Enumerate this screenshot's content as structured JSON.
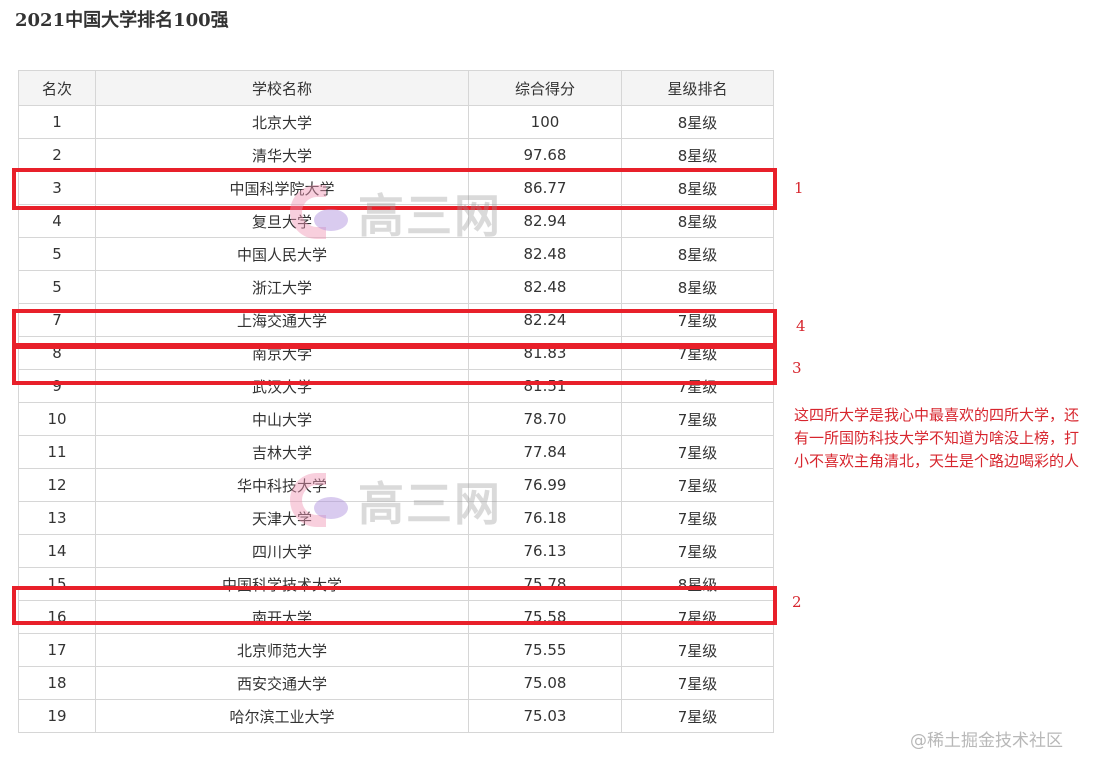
{
  "title": "2021中国大学排名100强",
  "table": {
    "headers": [
      "名次",
      "学校名称",
      "综合得分",
      "星级排名"
    ],
    "rows": [
      [
        "1",
        "北京大学",
        "100",
        "8星级"
      ],
      [
        "2",
        "清华大学",
        "97.68",
        "8星级"
      ],
      [
        "3",
        "中国科学院大学",
        "86.77",
        "8星级"
      ],
      [
        "4",
        "复旦大学",
        "82.94",
        "8星级"
      ],
      [
        "5",
        "中国人民大学",
        "82.48",
        "8星级"
      ],
      [
        "5",
        "浙江大学",
        "82.48",
        "8星级"
      ],
      [
        "7",
        "上海交通大学",
        "82.24",
        "7星级"
      ],
      [
        "8",
        "南京大学",
        "81.83",
        "7星级"
      ],
      [
        "9",
        "武汉大学",
        "81.51",
        "7星级"
      ],
      [
        "10",
        "中山大学",
        "78.70",
        "7星级"
      ],
      [
        "11",
        "吉林大学",
        "77.84",
        "7星级"
      ],
      [
        "12",
        "华中科技大学",
        "76.99",
        "7星级"
      ],
      [
        "13",
        "天津大学",
        "76.18",
        "7星级"
      ],
      [
        "14",
        "四川大学",
        "76.13",
        "7星级"
      ],
      [
        "15",
        "中国科学技术大学",
        "75.78",
        "8星级"
      ],
      [
        "16",
        "南开大学",
        "75.58",
        "7星级"
      ],
      [
        "17",
        "北京师范大学",
        "75.55",
        "7星级"
      ],
      [
        "18",
        "西安交通大学",
        "75.08",
        "7星级"
      ],
      [
        "19",
        "哈尔滨工业大学",
        "75.03",
        "7星级"
      ]
    ]
  },
  "annotations": {
    "numbers": [
      "1",
      "4",
      "3",
      "2"
    ],
    "comment": "这四所大学是我心中最喜欢的四所大学，还有一所国防科技大学不知道为啥没上榜，打小不喜欢主角清北，天生是个路边喝彩的人",
    "highlight_color": "#e8202a"
  },
  "watermark": {
    "text": "高三网"
  },
  "site_watermark": "@稀土掘金技术社区"
}
